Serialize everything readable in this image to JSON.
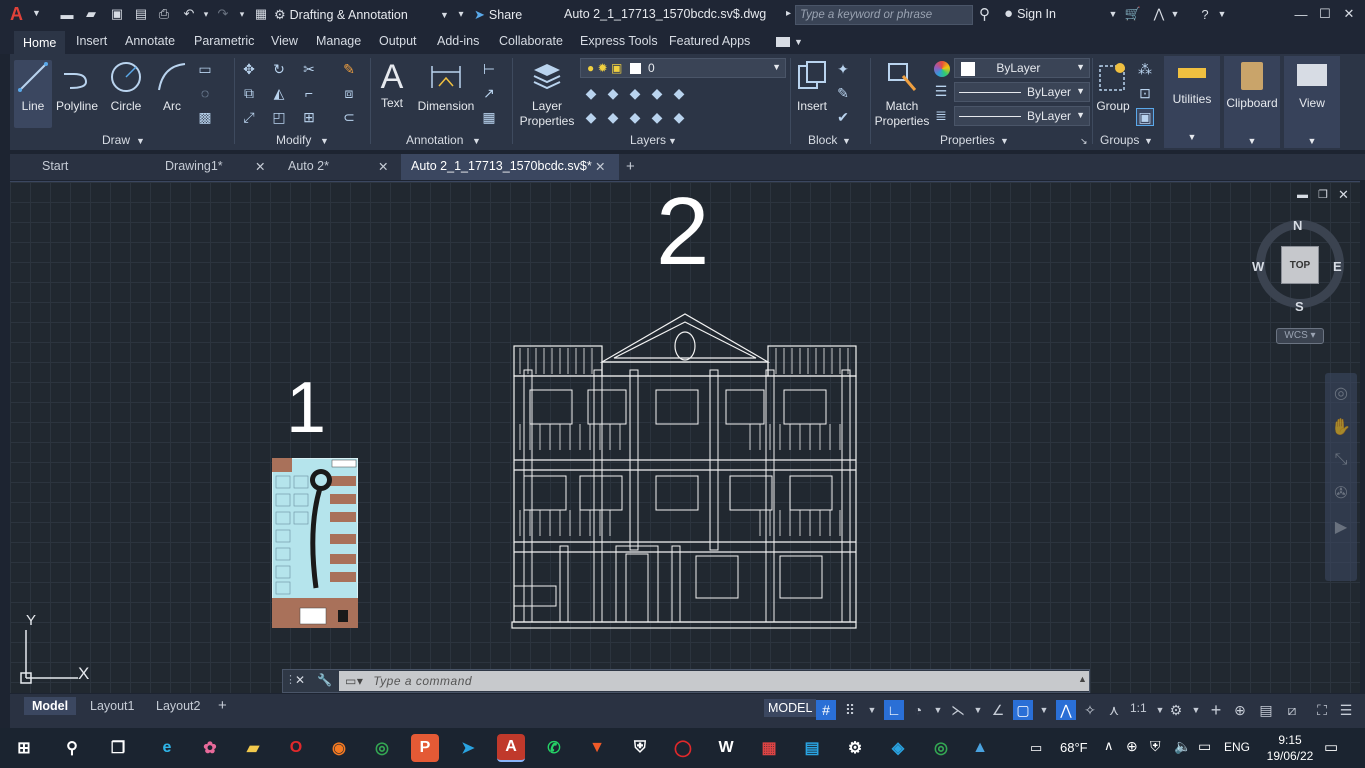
{
  "app": {
    "logo": "A",
    "workspace": "Drafting & Annotation",
    "share": "Share",
    "title": "Auto 2_1_17713_1570bcdc.sv$.dwg",
    "search_placeholder": "Type a keyword or phrase",
    "sign_in": "Sign In"
  },
  "ribbon_tabs": [
    "Home",
    "Insert",
    "Annotate",
    "Parametric",
    "View",
    "Manage",
    "Output",
    "Add-ins",
    "Collaborate",
    "Express Tools",
    "Featured Apps"
  ],
  "ribbon": {
    "draw": {
      "title": "Draw",
      "tools": [
        "Line",
        "Polyline",
        "Circle",
        "Arc"
      ]
    },
    "modify": {
      "title": "Modify"
    },
    "annotation": {
      "title": "Annotation",
      "tools": [
        "Text",
        "Dimension"
      ]
    },
    "layers": {
      "title": "Layers",
      "layer_properties": "Layer Properties",
      "current_layer": "0"
    },
    "block": {
      "title": "Block",
      "insert": "Insert"
    },
    "properties": {
      "title": "Properties",
      "match": "Match Properties",
      "color": "ByLayer",
      "linetype": "ByLayer",
      "lineweight": "ByLayer"
    },
    "groups": {
      "title": "Groups",
      "group": "Group"
    },
    "utilities": "Utilities",
    "clipboard": "Clipboard",
    "view": "View"
  },
  "doc_tabs": [
    {
      "label": "Start",
      "closable": false
    },
    {
      "label": "Drawing1*",
      "closable": true
    },
    {
      "label": "Auto 2*",
      "closable": true
    },
    {
      "label": "Auto 2_1_17713_1570bcdc.sv$*",
      "closable": true
    }
  ],
  "canvas": {
    "label1": "1",
    "label2": "2",
    "viewcube": {
      "n": "N",
      "s": "S",
      "e": "E",
      "w": "W",
      "top": "TOP",
      "wcs": "WCS"
    },
    "ucs": {
      "x": "X",
      "y": "Y"
    }
  },
  "command": {
    "placeholder": "Type a command"
  },
  "layouts": [
    "Model",
    "Layout1",
    "Layout2"
  ],
  "status": {
    "mode": "MODEL",
    "scale": "1:1"
  },
  "taskbar": {
    "weather": "68°F",
    "lang": "ENG",
    "time": "9:15",
    "date": "19/06/22"
  },
  "colors": {
    "accent": "#c0392b",
    "ribbon": "#2c3546",
    "canvas": "#212830"
  }
}
